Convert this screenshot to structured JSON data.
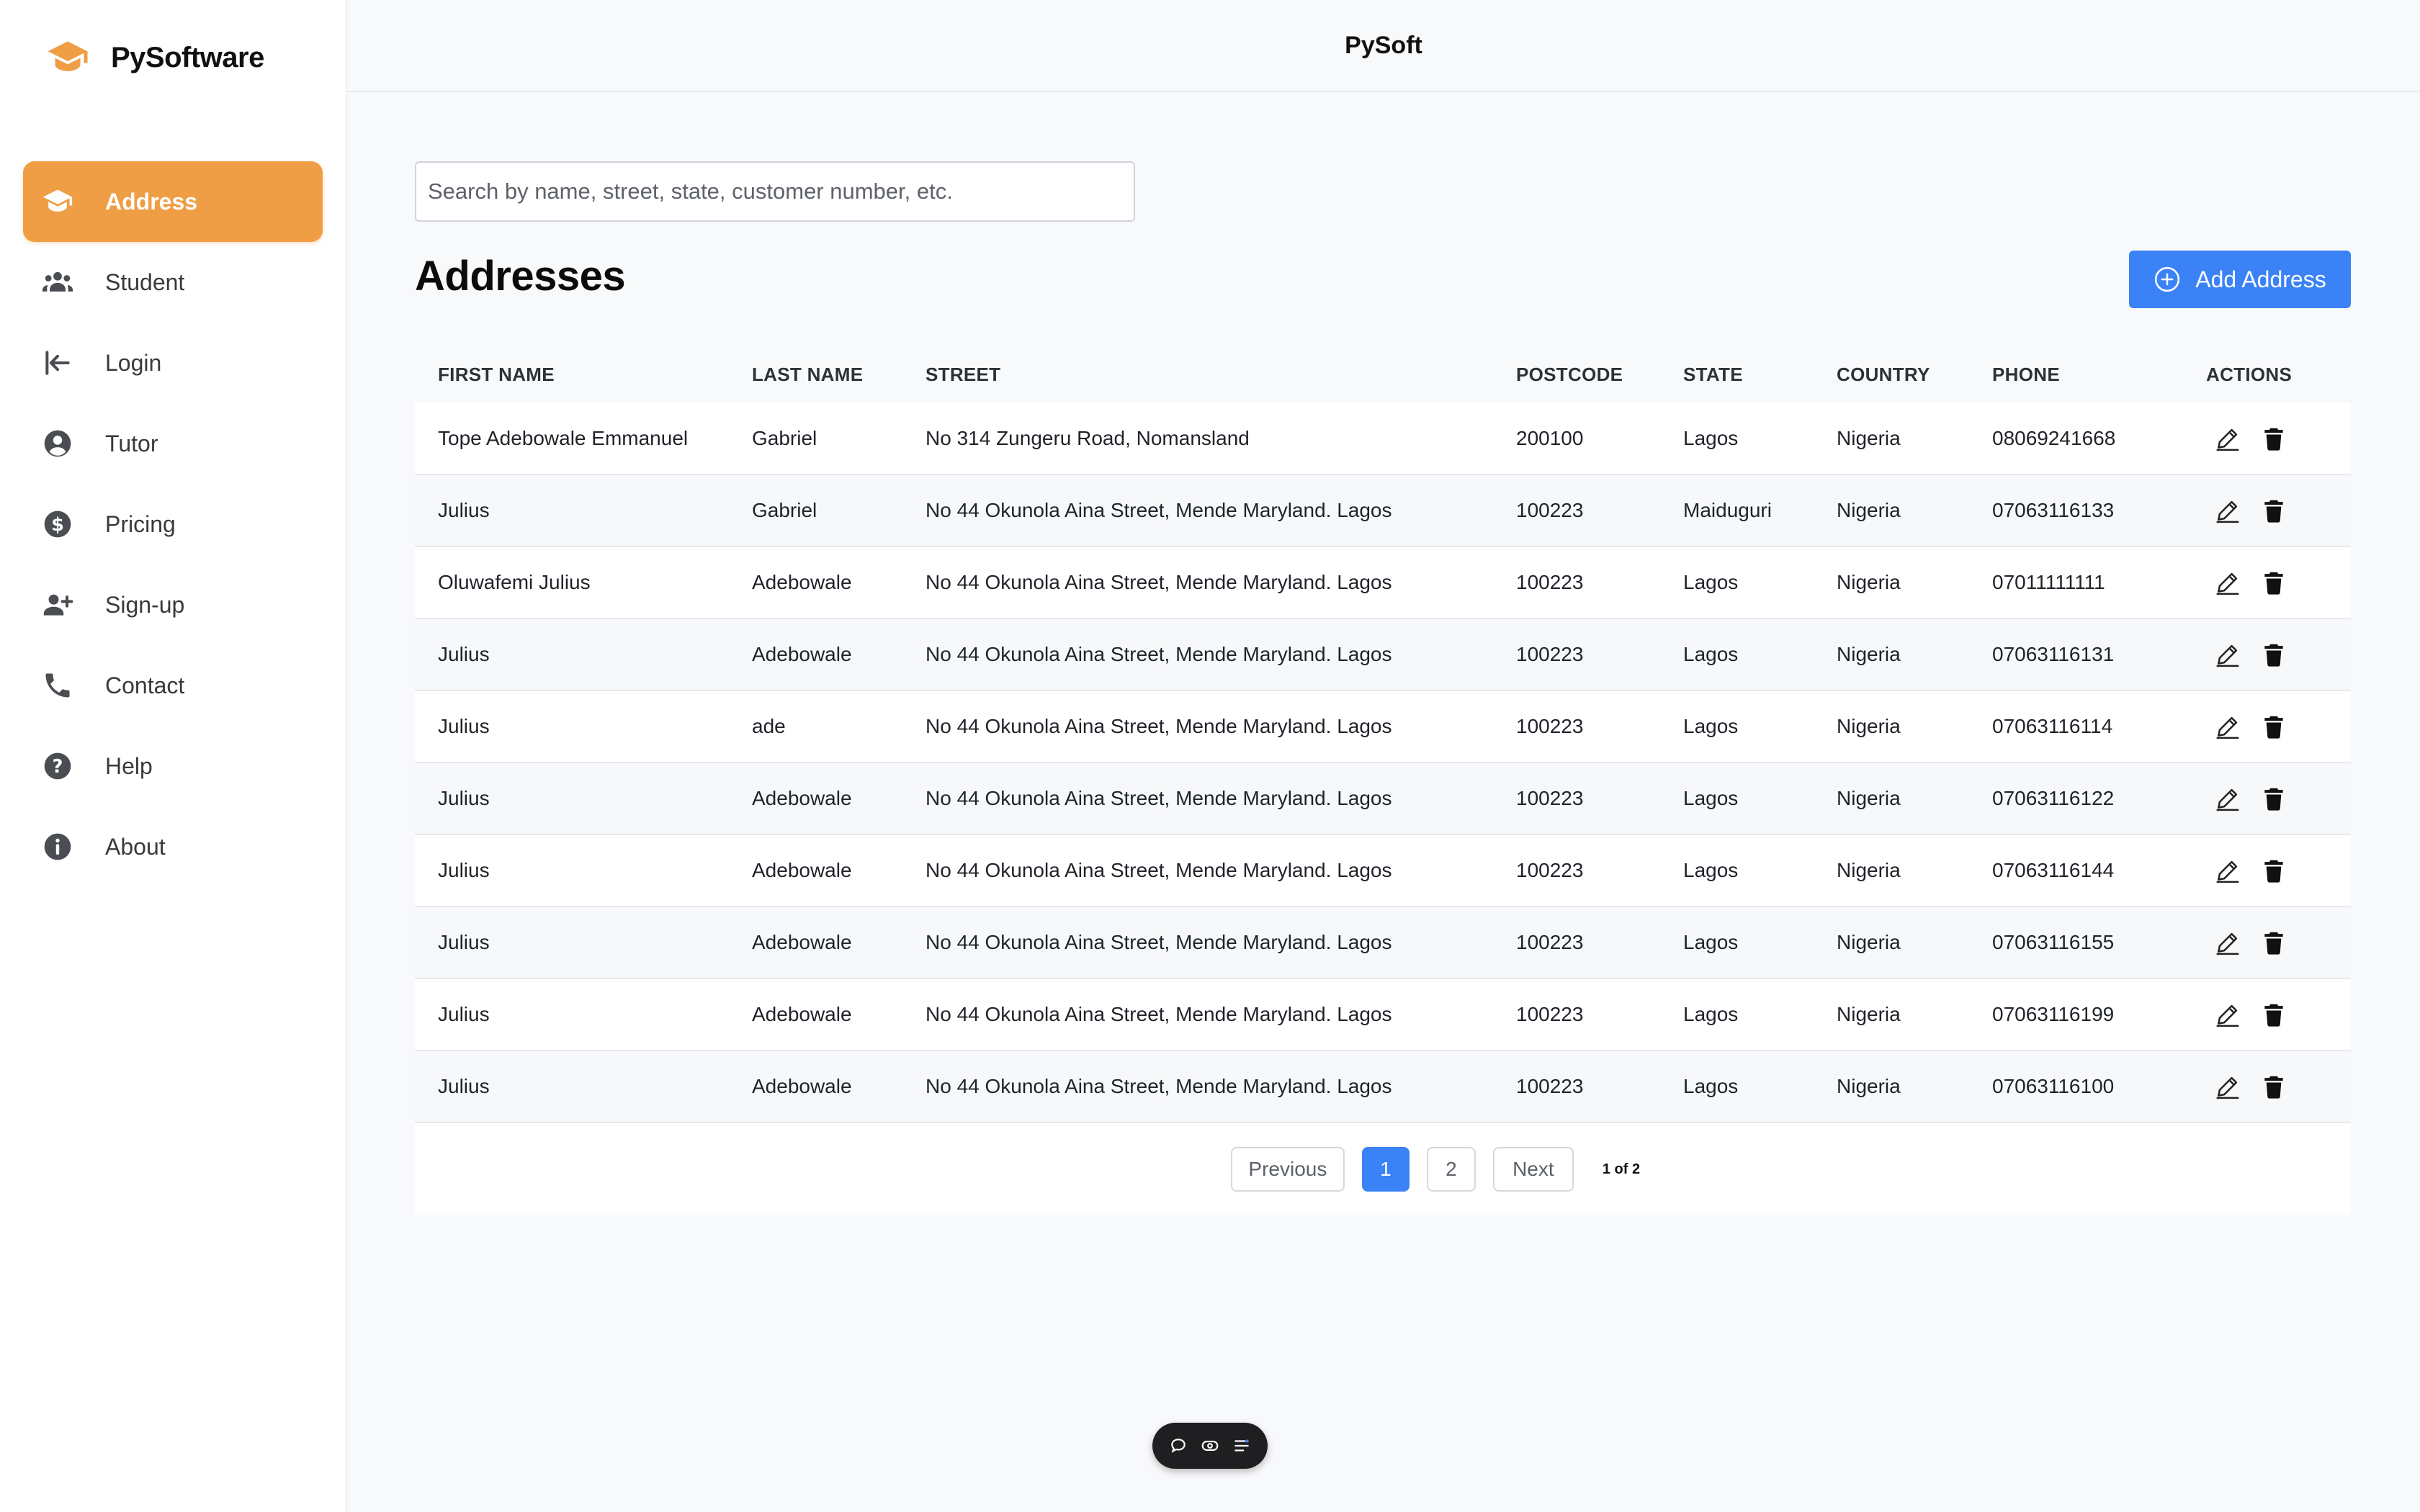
{
  "brand": {
    "name": "PySoftware"
  },
  "topbar": {
    "title": "PySoft"
  },
  "sidebar": {
    "items": [
      {
        "label": "Address",
        "icon": "graduation-cap-icon",
        "active": true
      },
      {
        "label": "Student",
        "icon": "users-icon"
      },
      {
        "label": "Login",
        "icon": "login-arrow-icon"
      },
      {
        "label": "Tutor",
        "icon": "user-circle-icon"
      },
      {
        "label": "Pricing",
        "icon": "dollar-circle-icon"
      },
      {
        "label": "Sign-up",
        "icon": "user-plus-icon"
      },
      {
        "label": "Contact",
        "icon": "phone-icon"
      },
      {
        "label": "Help",
        "icon": "question-circle-icon"
      },
      {
        "label": "About",
        "icon": "info-circle-icon"
      }
    ]
  },
  "search": {
    "placeholder": "Search by name, street, state, customer number, etc.",
    "value": ""
  },
  "main": {
    "title": "Addresses",
    "add_button": "Add Address",
    "accent_color": "#3b82f6",
    "brand_color": "#ef9e45"
  },
  "table": {
    "columns": [
      "FIRST NAME",
      "LAST NAME",
      "STREET",
      "POSTCODE",
      "STATE",
      "COUNTRY",
      "PHONE",
      "ACTIONS"
    ],
    "rows": [
      [
        "Tope Adebowale Emmanuel",
        "Gabriel",
        "No 314 Zungeru Road, Nomansland",
        "200100",
        "Lagos",
        "Nigeria",
        "08069241668"
      ],
      [
        "Julius",
        "Gabriel",
        "No 44 Okunola Aina Street, Mende Maryland. Lagos",
        "100223",
        "Maiduguri",
        "Nigeria",
        "07063116133"
      ],
      [
        "Oluwafemi Julius",
        "Adebowale",
        "No 44 Okunola Aina Street, Mende Maryland. Lagos",
        "100223",
        "Lagos",
        "Nigeria",
        "07011111111"
      ],
      [
        "Julius",
        "Adebowale",
        "No 44 Okunola Aina Street, Mende Maryland. Lagos",
        "100223",
        "Lagos",
        "Nigeria",
        "07063116131"
      ],
      [
        "Julius",
        "ade",
        "No 44 Okunola Aina Street, Mende Maryland. Lagos",
        "100223",
        "Lagos",
        "Nigeria",
        "07063116114"
      ],
      [
        "Julius",
        "Adebowale",
        "No 44 Okunola Aina Street, Mende Maryland. Lagos",
        "100223",
        "Lagos",
        "Nigeria",
        "07063116122"
      ],
      [
        "Julius",
        "Adebowale",
        "No 44 Okunola Aina Street, Mende Maryland. Lagos",
        "100223",
        "Lagos",
        "Nigeria",
        "07063116144"
      ],
      [
        "Julius",
        "Adebowale",
        "No 44 Okunola Aina Street, Mende Maryland. Lagos",
        "100223",
        "Lagos",
        "Nigeria",
        "07063116155"
      ],
      [
        "Julius",
        "Adebowale",
        "No 44 Okunola Aina Street, Mende Maryland. Lagos",
        "100223",
        "Lagos",
        "Nigeria",
        "07063116199"
      ],
      [
        "Julius",
        "Adebowale",
        "No 44 Okunola Aina Street, Mende Maryland. Lagos",
        "100223",
        "Lagos",
        "Nigeria",
        "07063116100"
      ]
    ],
    "row_actions": [
      "edit-icon",
      "trash-icon"
    ]
  },
  "pagination": {
    "previous": "Previous",
    "pages": [
      "1",
      "2"
    ],
    "current": "1",
    "next": "Next",
    "info": "1 of 2"
  },
  "dock": {
    "icons": [
      "comment-icon",
      "eye-icon",
      "sliders-icon"
    ]
  }
}
